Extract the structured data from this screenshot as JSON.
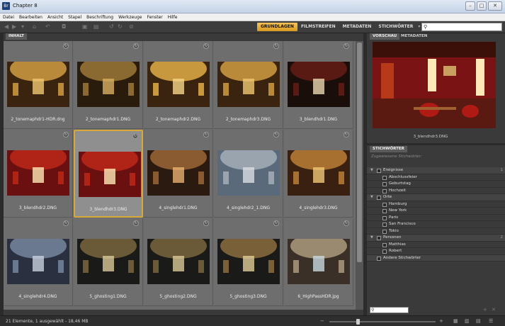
{
  "window": {
    "title": "Chapter 8",
    "app_icon": "Br"
  },
  "menu": [
    "Datei",
    "Bearbeiten",
    "Ansicht",
    "Stapel",
    "Beschriftung",
    "Werkzeuge",
    "Fenster",
    "Hilfe"
  ],
  "workspaces": [
    "GRUNDLAGEN",
    "FILMSTREIFEN",
    "METADATEN",
    "STICHWÖRTER"
  ],
  "workspace_active": "GRUNDLAGEN",
  "search": {
    "icon": "search-icon",
    "value": "",
    "placeholder": ""
  },
  "content_panel": {
    "tab_label": "INHALT"
  },
  "thumbnails": [
    {
      "label": "2_tonemaphdr1-HDR.dng"
    },
    {
      "label": "2_tonemaphdr1.DNG"
    },
    {
      "label": "2_tonemaphdr2.DNG"
    },
    {
      "label": "2_tonemaphdr3.DNG"
    },
    {
      "label": "3_blendhdr1.DNG"
    },
    {
      "label": "3_blendhdr2.DNG"
    },
    {
      "label": "3_blendhdr3.DNG"
    },
    {
      "label": "4_singlehdr1.DNG"
    },
    {
      "label": "4_singlehdr2_1.DNG"
    },
    {
      "label": "4_singlehdr3.DNG"
    },
    {
      "label": "4_singlehdr4.DNG"
    },
    {
      "label": "5_ghosting1.DNG"
    },
    {
      "label": "5_ghosting2.DNG"
    },
    {
      "label": "5_ghosting3.DNG"
    },
    {
      "label": "6_HighPassHDR.jpg"
    }
  ],
  "selected_index": 6,
  "preview_panel": {
    "tab_preview": "VORSCHAU",
    "tab_metadata": "METADATEN",
    "caption": "3_blendhdr3.DNG"
  },
  "keywords_panel": {
    "tab_label": "STICHWÖRTER",
    "assigned_label": "Zugewiesene Stichwörter:",
    "rows": [
      {
        "type": "group",
        "label": "Ereignisse",
        "count": "1"
      },
      {
        "type": "child",
        "label": "Abschlussfeier"
      },
      {
        "type": "child",
        "label": "Geburtstag"
      },
      {
        "type": "child",
        "label": "Hochzeit"
      },
      {
        "type": "group",
        "label": "Orte",
        "count": ""
      },
      {
        "type": "child",
        "label": "Hamburg"
      },
      {
        "type": "child",
        "label": "New York"
      },
      {
        "type": "child",
        "label": "Paris"
      },
      {
        "type": "child",
        "label": "San Francisco"
      },
      {
        "type": "child",
        "label": "Tokio"
      },
      {
        "type": "group",
        "label": "Personen",
        "count": "2"
      },
      {
        "type": "child",
        "label": "Matthias"
      },
      {
        "type": "child",
        "label": "Robert"
      },
      {
        "type": "group",
        "label": "Andere Stichwörter",
        "count": "",
        "no_arrow": true
      }
    ]
  },
  "status": {
    "text": "21 Elemente, 1 ausgewählt - 18,46 MB"
  },
  "colors": {
    "accent": "#d79a1f",
    "panel": "#3a3a3a",
    "grid": "#6c6c6c"
  }
}
